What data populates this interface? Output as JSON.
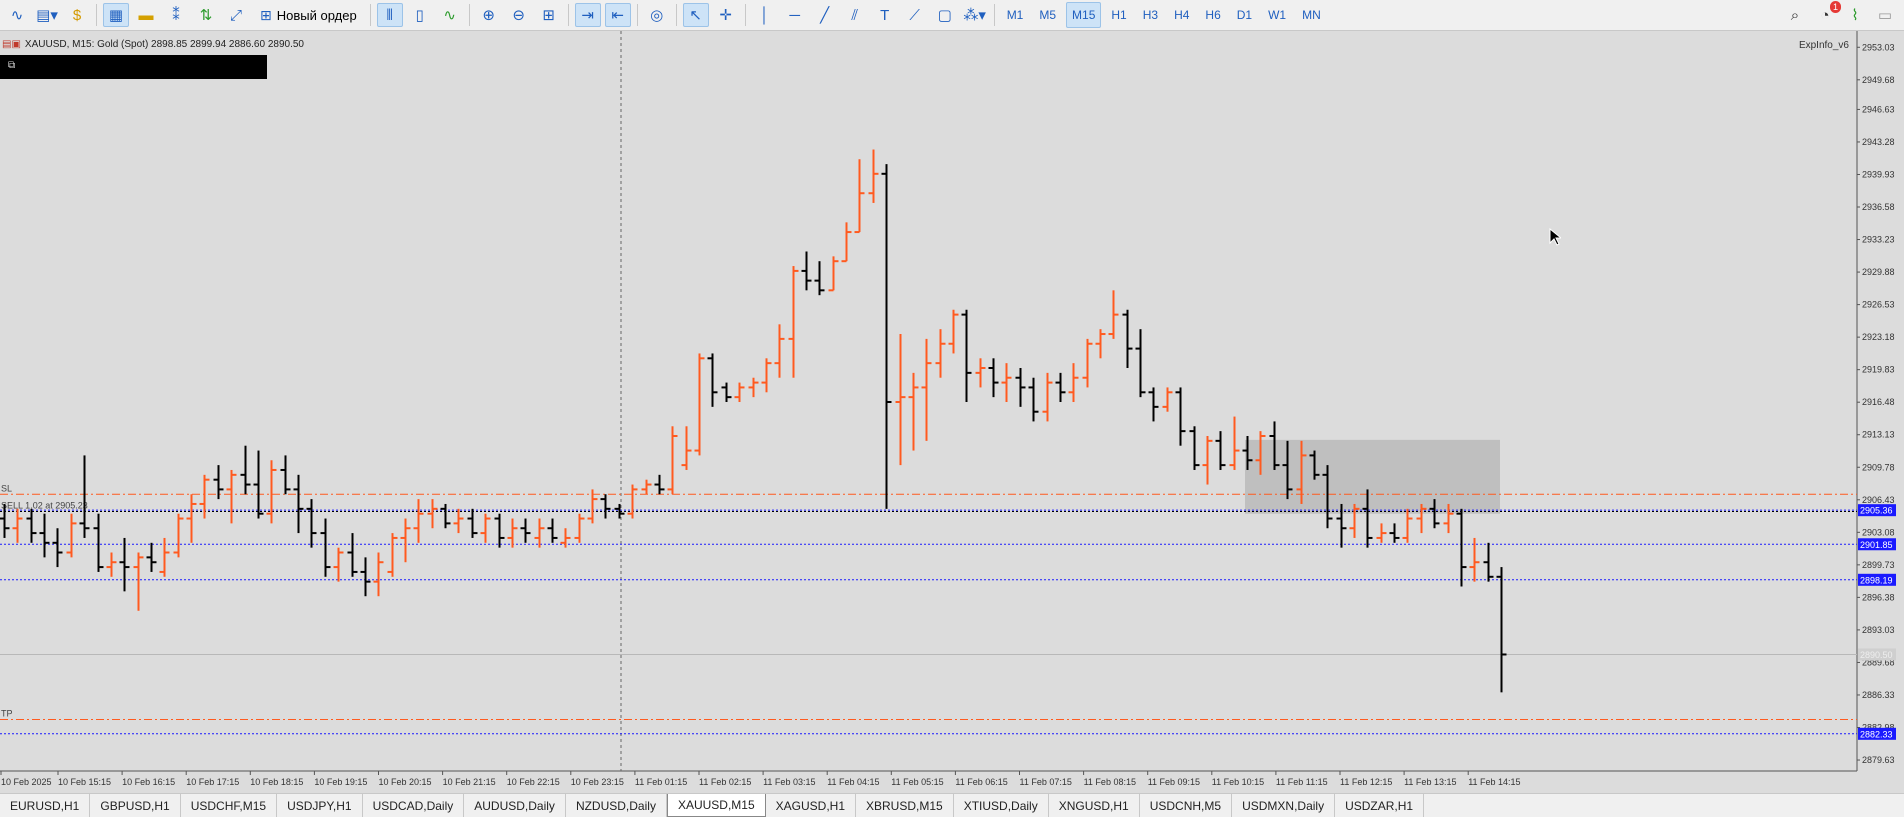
{
  "toolbar": {
    "new_order_label": "Новый ордер",
    "timeframes": [
      "M1",
      "M5",
      "M15",
      "H1",
      "H3",
      "H4",
      "H6",
      "D1",
      "W1",
      "MN"
    ],
    "active_timeframe": "M15",
    "notification_count": "1"
  },
  "chart": {
    "symbol_line": "XAUUSD, M15:  Gold (Spot)  2898.85 2899.94 2886.60 2890.50",
    "indicator_label": "ExpInfo_v6",
    "sl_label": "SL",
    "order_label": "SELL 1.02 at 2905.23",
    "tp_label": "TP",
    "price_ticks": [
      "2953.03",
      "2949.68",
      "2946.63",
      "2943.28",
      "2939.93",
      "2936.58",
      "2933.23",
      "2929.88",
      "2926.53",
      "2923.18",
      "2919.83",
      "2916.48",
      "2913.13",
      "2909.78",
      "2906.43",
      "2903.08",
      "2899.73",
      "2896.38",
      "2893.03",
      "2889.68",
      "2886.33",
      "2882.98",
      "2879.63"
    ],
    "price_markers": [
      {
        "value": "2905.36",
        "kind": "blue"
      },
      {
        "value": "2901.85",
        "kind": "blue"
      },
      {
        "value": "2898.19",
        "kind": "blue"
      },
      {
        "value": "2890.50",
        "kind": "gray"
      },
      {
        "value": "2882.33",
        "kind": "blue"
      }
    ],
    "time_labels": [
      "10 Feb 2025",
      "10 Feb 15:15",
      "10 Feb 16:15",
      "10 Feb 17:15",
      "10 Feb 18:15",
      "10 Feb 19:15",
      "10 Feb 20:15",
      "10 Feb 21:15",
      "10 Feb 22:15",
      "10 Feb 23:15",
      "11 Feb 01:15",
      "11 Feb 02:15",
      "11 Feb 03:15",
      "11 Feb 04:15",
      "11 Feb 05:15",
      "11 Feb 06:15",
      "11 Feb 07:15",
      "11 Feb 08:15",
      "11 Feb 09:15",
      "11 Feb 10:15",
      "11 Feb 11:15",
      "11 Feb 12:15",
      "11 Feb 13:15",
      "11 Feb 14:15"
    ],
    "colors": {
      "background": "#dcdcdc",
      "bull": "#ff5a1f",
      "bear": "#000000",
      "blue_line": "#1a1aff",
      "red_line": "#ff5a1f",
      "zone": "#bfbfbf"
    }
  },
  "chart_data": {
    "type": "ohlc",
    "symbol": "XAUUSD",
    "timeframe": "M15",
    "ylim": [
      2878.5,
      2954.5
    ],
    "levels": {
      "sl": 2907.0,
      "sell_entry": 2905.23,
      "blue_lines": [
        2905.36,
        2901.85,
        2898.19,
        2882.33
      ],
      "current": 2890.5,
      "tp": 2883.8
    },
    "zone": {
      "from": 2905.0,
      "to": 2912.6
    },
    "bars": [
      [
        2904.5,
        2906.0,
        2902.5,
        2903.5
      ],
      [
        2903.5,
        2905.5,
        2902.0,
        2904.5
      ],
      [
        2904.5,
        2905.5,
        2902.0,
        2903.0
      ],
      [
        2903.0,
        2905.0,
        2900.5,
        2902.0
      ],
      [
        2902.0,
        2903.5,
        2899.5,
        2901.0
      ],
      [
        2901.0,
        2905.0,
        2900.5,
        2904.0
      ],
      [
        2904.0,
        2911.0,
        2902.5,
        2903.5
      ],
      [
        2903.5,
        2905.0,
        2899.0,
        2899.5
      ],
      [
        2899.5,
        2901.0,
        2898.5,
        2900.0
      ],
      [
        2900.0,
        2902.5,
        2897.0,
        2899.5
      ],
      [
        2899.5,
        2901.0,
        2895.0,
        2900.5
      ],
      [
        2900.5,
        2902.0,
        2899.0,
        2900.0
      ],
      [
        2899.0,
        2902.5,
        2898.5,
        2901.0
      ],
      [
        2901.0,
        2905.0,
        2900.5,
        2904.5
      ],
      [
        2904.5,
        2907.0,
        2902.0,
        2906.0
      ],
      [
        2906.0,
        2909.0,
        2904.5,
        2908.5
      ],
      [
        2908.5,
        2910.0,
        2906.5,
        2907.5
      ],
      [
        2907.5,
        2909.5,
        2904.0,
        2909.0
      ],
      [
        2909.0,
        2912.0,
        2907.0,
        2908.0
      ],
      [
        2908.0,
        2911.5,
        2904.5,
        2905.0
      ],
      [
        2905.0,
        2910.5,
        2904.0,
        2909.5
      ],
      [
        2909.5,
        2911.0,
        2907.0,
        2907.5
      ],
      [
        2907.5,
        2909.0,
        2903.0,
        2905.5
      ],
      [
        2905.5,
        2906.5,
        2901.5,
        2903.0
      ],
      [
        2903.0,
        2904.5,
        2898.5,
        2899.5
      ],
      [
        2899.5,
        2901.5,
        2898.0,
        2901.0
      ],
      [
        2901.0,
        2903.0,
        2898.5,
        2899.0
      ],
      [
        2899.0,
        2900.5,
        2896.5,
        2898.0
      ],
      [
        2898.0,
        2901.0,
        2896.5,
        2900.0
      ],
      [
        2899.0,
        2903.0,
        2898.5,
        2902.5
      ],
      [
        2902.5,
        2904.5,
        2900.0,
        2903.5
      ],
      [
        2903.5,
        2906.5,
        2902.0,
        2905.0
      ],
      [
        2905.0,
        2906.5,
        2903.5,
        2905.5
      ],
      [
        2905.5,
        2906.0,
        2903.5,
        2904.0
      ],
      [
        2904.0,
        2905.5,
        2903.0,
        2904.5
      ],
      [
        2904.5,
        2905.5,
        2902.5,
        2903.0
      ],
      [
        2903.0,
        2905.0,
        2902.0,
        2904.5
      ],
      [
        2904.5,
        2905.0,
        2901.5,
        2902.5
      ],
      [
        2902.5,
        2904.5,
        2901.5,
        2903.5
      ],
      [
        2903.5,
        2904.5,
        2902.0,
        2903.0
      ],
      [
        2902.5,
        2904.5,
        2901.5,
        2903.5
      ],
      [
        2903.5,
        2904.5,
        2902.0,
        2902.5
      ],
      [
        2902.0,
        2903.5,
        2901.5,
        2902.5
      ],
      [
        2902.5,
        2905.0,
        2902.0,
        2904.5
      ],
      [
        2904.5,
        2907.5,
        2904.0,
        2906.5
      ],
      [
        2906.5,
        2907.0,
        2904.5,
        2905.5
      ],
      [
        2905.5,
        2906.0,
        2904.5,
        2905.0
      ],
      [
        2905.0,
        2908.0,
        2904.5,
        2907.5
      ],
      [
        2907.5,
        2908.5,
        2907.0,
        2908.0
      ],
      [
        2908.0,
        2909.0,
        2907.0,
        2907.5
      ],
      [
        2907.5,
        2914.0,
        2907.0,
        2913.0
      ],
      [
        2910.0,
        2914.0,
        2909.5,
        2911.5
      ],
      [
        2911.5,
        2921.5,
        2911.0,
        2921.0
      ],
      [
        2921.0,
        2921.5,
        2916.0,
        2917.5
      ],
      [
        2918.0,
        2918.5,
        2916.5,
        2917.0
      ],
      [
        2917.0,
        2918.5,
        2916.5,
        2918.0
      ],
      [
        2918.0,
        2919.0,
        2917.0,
        2918.5
      ],
      [
        2918.5,
        2921.0,
        2917.5,
        2920.5
      ],
      [
        2920.5,
        2924.5,
        2919.0,
        2923.0
      ],
      [
        2923.0,
        2930.5,
        2919.0,
        2930.0
      ],
      [
        2930.0,
        2932.0,
        2928.0,
        2929.0
      ],
      [
        2929.0,
        2931.0,
        2927.5,
        2928.0
      ],
      [
        2928.0,
        2931.5,
        2928.0,
        2931.0
      ],
      [
        2931.0,
        2935.0,
        2931.0,
        2934.0
      ],
      [
        2934.0,
        2941.5,
        2934.0,
        2938.0
      ],
      [
        2938.0,
        2942.5,
        2937.0,
        2940.0
      ],
      [
        2940.0,
        2941.0,
        2905.5,
        2916.5
      ],
      [
        2916.5,
        2923.5,
        2910.0,
        2917.0
      ],
      [
        2917.0,
        2919.5,
        2911.5,
        2918.0
      ],
      [
        2918.0,
        2923.0,
        2912.5,
        2920.5
      ],
      [
        2920.5,
        2924.0,
        2919.0,
        2922.5
      ],
      [
        2922.5,
        2926.0,
        2921.5,
        2925.5
      ],
      [
        2925.5,
        2926.0,
        2916.5,
        2919.5
      ],
      [
        2919.5,
        2921.0,
        2918.0,
        2920.0
      ],
      [
        2920.0,
        2921.0,
        2917.0,
        2918.5
      ],
      [
        2918.5,
        2920.5,
        2916.5,
        2919.0
      ],
      [
        2919.0,
        2920.0,
        2916.0,
        2918.0
      ],
      [
        2918.0,
        2919.0,
        2914.5,
        2915.5
      ],
      [
        2915.5,
        2919.5,
        2914.5,
        2918.5
      ],
      [
        2918.5,
        2919.5,
        2916.5,
        2917.5
      ],
      [
        2917.5,
        2920.5,
        2916.5,
        2919.0
      ],
      [
        2919.0,
        2923.0,
        2918.0,
        2922.5
      ],
      [
        2922.5,
        2924.0,
        2921.0,
        2923.5
      ],
      [
        2923.5,
        2928.0,
        2923.0,
        2925.5
      ],
      [
        2925.5,
        2926.0,
        2920.0,
        2922.0
      ],
      [
        2922.0,
        2924.0,
        2917.0,
        2917.5
      ],
      [
        2917.5,
        2918.0,
        2914.5,
        2916.0
      ],
      [
        2916.0,
        2918.0,
        2915.5,
        2917.5
      ],
      [
        2917.5,
        2918.0,
        2912.0,
        2913.5
      ],
      [
        2913.5,
        2914.0,
        2909.5,
        2910.0
      ],
      [
        2910.0,
        2913.0,
        2908.0,
        2912.5
      ],
      [
        2912.5,
        2913.5,
        2909.5,
        2910.0
      ],
      [
        2910.0,
        2915.0,
        2909.5,
        2911.5
      ],
      [
        2911.5,
        2913.0,
        2909.5,
        2910.5
      ],
      [
        2910.5,
        2913.5,
        2909.0,
        2913.0
      ],
      [
        2913.0,
        2914.5,
        2909.5,
        2910.0
      ],
      [
        2910.0,
        2912.5,
        2906.5,
        2907.5
      ],
      [
        2907.5,
        2912.5,
        2906.0,
        2911.0
      ],
      [
        2911.0,
        2911.5,
        2908.5,
        2909.0
      ],
      [
        2909.0,
        2910.0,
        2903.5,
        2904.5
      ],
      [
        2904.5,
        2906.0,
        2901.5,
        2903.5
      ],
      [
        2903.5,
        2906.0,
        2902.5,
        2905.5
      ],
      [
        2905.5,
        2907.5,
        2901.5,
        2902.5
      ],
      [
        2902.5,
        2904.0,
        2902.0,
        2903.0
      ],
      [
        2903.0,
        2904.0,
        2902.0,
        2902.5
      ],
      [
        2902.5,
        2905.5,
        2902.0,
        2904.5
      ],
      [
        2904.5,
        2906.0,
        2903.0,
        2905.5
      ],
      [
        2905.5,
        2906.5,
        2903.5,
        2904.0
      ],
      [
        2904.0,
        2906.0,
        2903.0,
        2905.0
      ],
      [
        2905.0,
        2905.5,
        2897.5,
        2899.5
      ],
      [
        2899.5,
        2902.5,
        2898.0,
        2900.0
      ],
      [
        2900.0,
        2902.0,
        2898.0,
        2898.5
      ],
      [
        2898.5,
        2899.5,
        2886.6,
        2890.5
      ]
    ]
  }
}
